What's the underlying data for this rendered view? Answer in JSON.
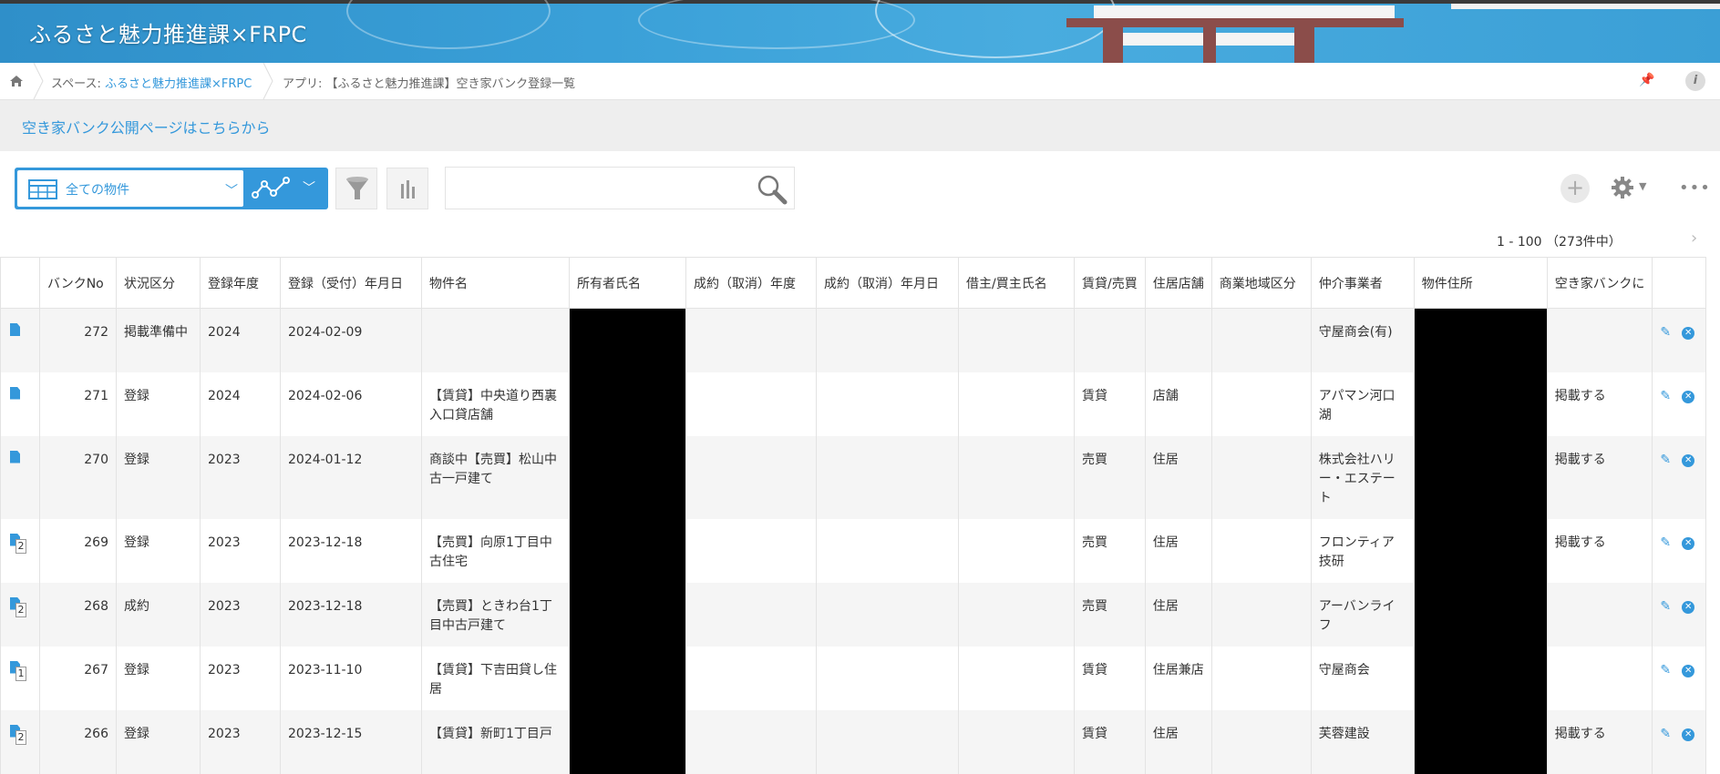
{
  "header": {
    "space_title": "ふるさと魅力推進課×FRPC"
  },
  "breadcrumb": {
    "space_prefix": "スペース: ",
    "space_link": "ふるさと魅力推進課×FRPC",
    "app": "アプリ: 【ふるさと魅力推進課】空き家バンク登録一覧"
  },
  "notice": {
    "link": "空き家バンク公開ページはこちらから"
  },
  "toolbar": {
    "view_label": "全ての物件",
    "search_placeholder": ""
  },
  "pager": {
    "range": "1 - 100 （273件中）",
    "next": "›"
  },
  "icons": {
    "home": "home-icon",
    "pin": "pin-icon",
    "info": "info-icon",
    "table": "table-view-icon",
    "graph": "graph-icon",
    "filter": "filter-icon",
    "chart": "bar-chart-icon",
    "search": "search-icon",
    "add": "add-icon",
    "gear": "gear-icon",
    "more": "more-icon",
    "detail": "record-detail-icon",
    "edit": "edit-pencil-icon",
    "delete": "delete-icon"
  },
  "colors": {
    "accent": "#3498db",
    "banner": "#3aa0d8",
    "notice_bg": "#eeeeee",
    "row_alt": "#f5f5f5"
  },
  "table": {
    "columns": [
      "",
      "バンクNo",
      "状況区分",
      "登録年度",
      "登録（受付）年月日",
      "物件名",
      "所有者氏名",
      "成約（取消）年度",
      "成約（取消）年月日",
      "借主/買主氏名",
      "賃貸/売買",
      "住居店舗",
      "商業地域区分",
      "仲介事業者",
      "物件住所",
      "空き家バンクに",
      ""
    ],
    "rows": [
      {
        "badge": "",
        "no": "272",
        "status": "掲載準備中",
        "year": "2024",
        "date": "2024-02-09",
        "name": "",
        "deal_year": "",
        "deal_date": "",
        "tenant": "",
        "type": "",
        "use": "",
        "zone": "",
        "agent": "守屋商会(有)",
        "publish": ""
      },
      {
        "badge": "",
        "no": "271",
        "status": "登録",
        "year": "2024",
        "date": "2024-02-06",
        "name": "【賃貸】中央道り西裏入口貸店舗",
        "deal_year": "",
        "deal_date": "",
        "tenant": "",
        "type": "賃貸",
        "use": "店舗",
        "zone": "",
        "agent": "アパマン河口湖",
        "publish": "掲載する"
      },
      {
        "badge": "",
        "no": "270",
        "status": "登録",
        "year": "2023",
        "date": "2024-01-12",
        "name": "商談中【売買】松山中古一戸建て",
        "deal_year": "",
        "deal_date": "",
        "tenant": "",
        "type": "売買",
        "use": "住居",
        "zone": "",
        "agent": "株式会社ハリー・エステート",
        "publish": "掲載する"
      },
      {
        "badge": "2",
        "no": "269",
        "status": "登録",
        "year": "2023",
        "date": "2023-12-18",
        "name": "【売買】向原1丁目中古住宅",
        "deal_year": "",
        "deal_date": "",
        "tenant": "",
        "type": "売買",
        "use": "住居",
        "zone": "",
        "agent": "フロンティア技研",
        "publish": "掲載する"
      },
      {
        "badge": "2",
        "no": "268",
        "status": "成約",
        "year": "2023",
        "date": "2023-12-18",
        "name": "【売買】ときわ台1丁目中古戸建て",
        "deal_year": "",
        "deal_date": "",
        "tenant": "",
        "type": "売買",
        "use": "住居",
        "zone": "",
        "agent": "アーバンライフ",
        "publish": ""
      },
      {
        "badge": "1",
        "no": "267",
        "status": "登録",
        "year": "2023",
        "date": "2023-11-10",
        "name": "【賃貸】下吉田貸し住居",
        "deal_year": "",
        "deal_date": "",
        "tenant": "",
        "type": "賃貸",
        "use": "住居兼店",
        "zone": "",
        "agent": "守屋商会",
        "publish": ""
      },
      {
        "badge": "2",
        "no": "266",
        "status": "登録",
        "year": "2023",
        "date": "2023-12-15",
        "name": "【賃貸】新町1丁目戸",
        "deal_year": "",
        "deal_date": "",
        "tenant": "",
        "type": "賃貸",
        "use": "住居",
        "zone": "",
        "agent": "芙蓉建設",
        "publish": "掲載する"
      }
    ]
  }
}
